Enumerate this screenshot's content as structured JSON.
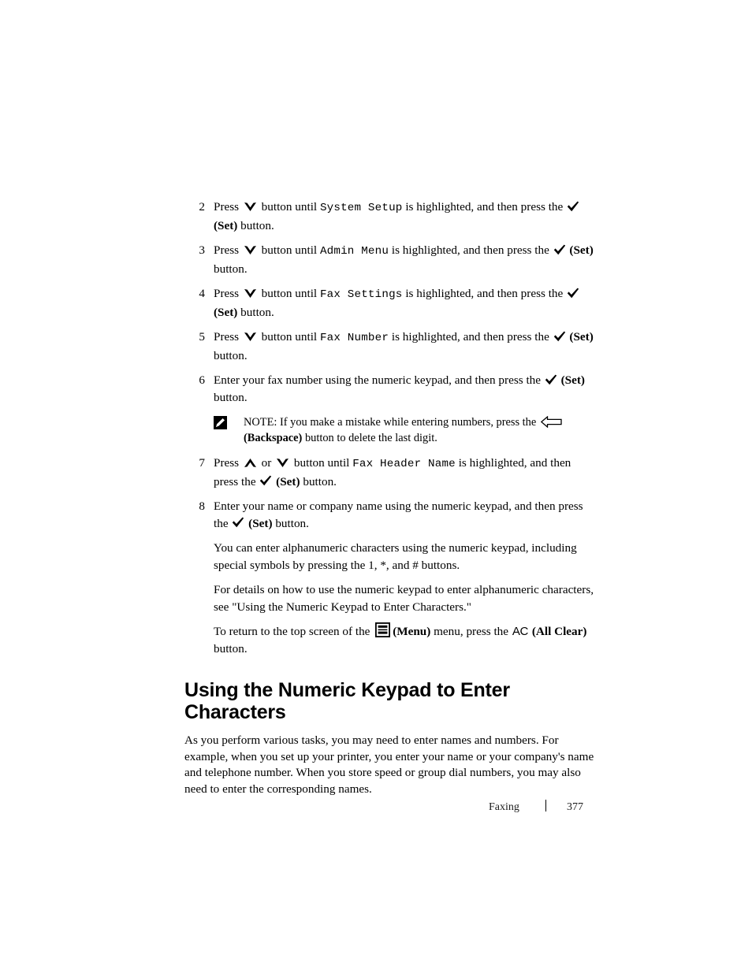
{
  "document": {
    "footer": {
      "section": "Faxing",
      "separator": "|",
      "page_number": "377"
    }
  },
  "steps": [
    {
      "number": "2",
      "t1": "Press ",
      "icon1": "down-chevron-icon",
      "t2": " button until ",
      "mono": "System Setup",
      "t3": " is highlighted, and then press the ",
      "icon2": "check-icon",
      "t4": " ",
      "bold": "(Set)",
      "t5": " button."
    },
    {
      "number": "3",
      "t1": "Press ",
      "icon1": "down-chevron-icon",
      "t2": " button until ",
      "mono": "Admin Menu",
      "t3": " is highlighted, and then press the ",
      "icon2": "check-icon",
      "t4": " ",
      "bold": "(Set)",
      "t5": " button."
    },
    {
      "number": "4",
      "t1": "Press ",
      "icon1": "down-chevron-icon",
      "t2": " button until ",
      "mono": "Fax Settings",
      "t3": " is highlighted, and then press the ",
      "icon2": "check-icon",
      "t4": " ",
      "bold": "(Set)",
      "t5": " button."
    },
    {
      "number": "5",
      "t1": "Press ",
      "icon1": "down-chevron-icon",
      "t2": " button until ",
      "mono": "Fax Number",
      "t3": " is highlighted, and then press the ",
      "icon2": "check-icon",
      "t4": " ",
      "bold": "(Set)",
      "t5": " button."
    }
  ],
  "step6": {
    "number": "6",
    "t1": "Enter your fax number using the numeric keypad, and then press the ",
    "bold": "(Set)",
    "t2": " button."
  },
  "note": {
    "icon": "note-pencil-icon",
    "label": "NOTE:",
    "t1": " If you make a mistake while entering numbers, press the ",
    "bold": "(Backspace)",
    "t2": " button to delete the last digit."
  },
  "step7": {
    "number": "7",
    "t1": "Press ",
    "t2": " or ",
    "t3": " button until ",
    "mono": "Fax Header Name",
    "t4": " is highlighted, and then press the ",
    "bold": "(Set)",
    "t5": " button."
  },
  "step8": {
    "number": "8",
    "t1": "Enter your name or company name using the numeric keypad, and then press the ",
    "bold": "(Set)",
    "t2": " button."
  },
  "paragraphs": {
    "p1": "You can enter alphanumeric characters using the numeric keypad, including special symbols by pressing the 1, *, and # buttons.",
    "p2": "For details on how to use the numeric keypad to enter alphanumeric characters, see \"Using the Numeric Keypad to Enter Characters.\"",
    "p3_t1": "To return to the top screen of the ",
    "p3_menu_bold": "(Menu)",
    "p3_t2": " menu, press the ",
    "p3_ac": "AC",
    "p3_allclear_bold": "(All Clear)",
    "p3_t3": " button."
  },
  "section": {
    "heading": "Using the Numeric Keypad to Enter Characters",
    "body": "As you perform various tasks, you may need to enter names and numbers. For example, when you set up your printer, you enter your name or your company's name and telephone number. When you store speed or group dial numbers, you may also need to enter the corresponding names."
  }
}
